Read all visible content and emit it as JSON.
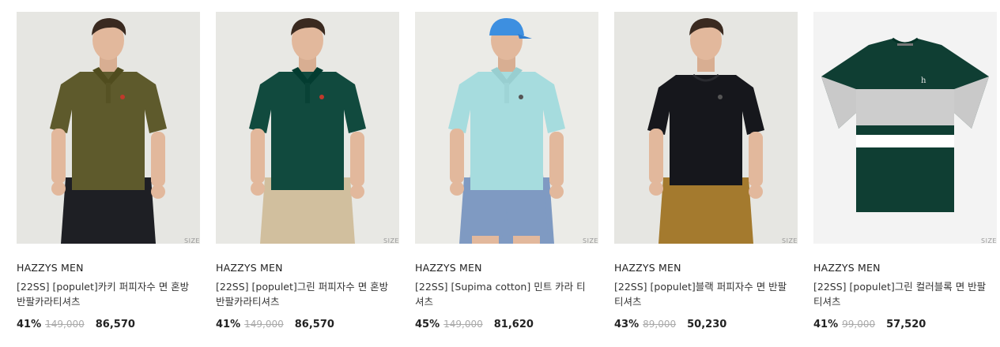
{
  "products": [
    {
      "brand": "HAZZYS MEN",
      "name": "[22SS] [populet]카키 퍼피자수 면 혼방 반팔카라티셔츠",
      "discount": "41%",
      "original_price": "149,000",
      "price": "86,570",
      "size_label": "SIZE",
      "bg": "#e6e6e2",
      "shirt_color": "#5e5a2c",
      "pants_color": "#1e1f24",
      "style": "polo"
    },
    {
      "brand": "HAZZYS MEN",
      "name": "[22SS] [populet]그린 퍼피자수 면 혼방 반팔카라티셔츠",
      "discount": "41%",
      "original_price": "149,000",
      "price": "86,570",
      "size_label": "SIZE",
      "bg": "#e8e8e4",
      "shirt_color": "#114a3e",
      "pants_color": "#d1bf9e",
      "style": "polo"
    },
    {
      "brand": "HAZZYS MEN",
      "name": "[22SS] [Supima cotton] 민트 카라 티셔츠",
      "discount": "45%",
      "original_price": "149,000",
      "price": "81,620",
      "size_label": "SIZE",
      "bg": "#ebebe7",
      "shirt_color": "#a6dcde",
      "pants_color": "#7f9ac2",
      "style": "polo-cap"
    },
    {
      "brand": "HAZZYS MEN",
      "name": "[22SS] [populet]블랙 퍼피자수 면 반팔티셔츠",
      "discount": "43%",
      "original_price": "89,000",
      "price": "50,230",
      "size_label": "SIZE",
      "bg": "#e6e6e2",
      "shirt_color": "#16171c",
      "pants_color": "#a47a2e",
      "style": "tee"
    },
    {
      "brand": "HAZZYS MEN",
      "name": "[22SS] [populet]그린 컬러블록 면 반팔티셔츠",
      "discount": "41%",
      "original_price": "99,000",
      "price": "57,520",
      "size_label": "SIZE",
      "bg": "#f3f3f3",
      "shirt_color": "#0f3e33",
      "pants_color": "",
      "style": "flat"
    }
  ]
}
